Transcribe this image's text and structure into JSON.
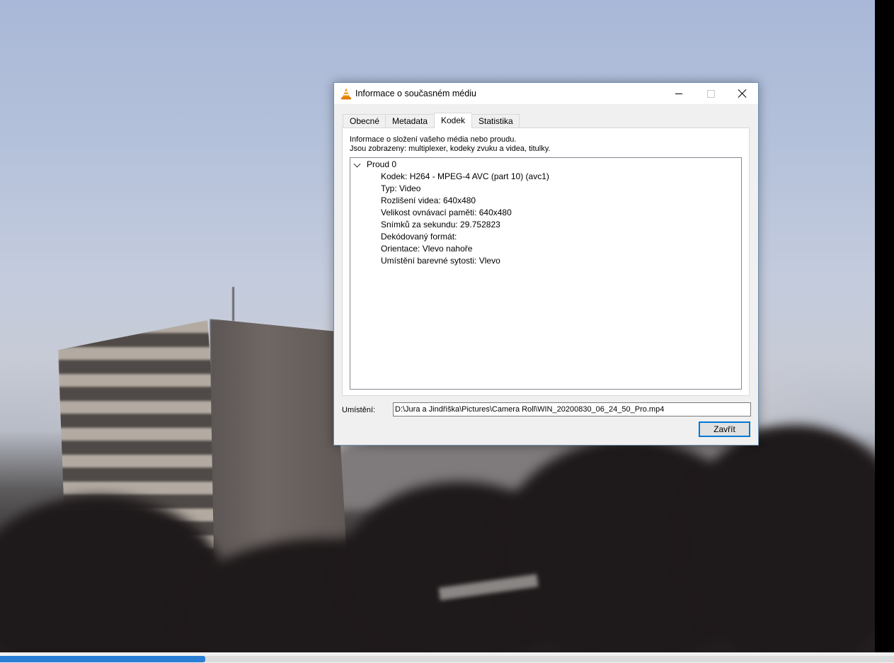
{
  "player": {
    "progress_fraction": 0.23
  },
  "dialog": {
    "title": "Informace o současném médiu",
    "tabs": [
      {
        "label": "Obecné"
      },
      {
        "label": "Metadata"
      },
      {
        "label": "Kodek"
      },
      {
        "label": "Statistika"
      }
    ],
    "active_tab": "Kodek",
    "description_line1": "Informace o složení vašeho média nebo proudu.",
    "description_line2": "Jsou zobrazeny: multiplexer, kodeky zvuku a videa, titulky.",
    "stream": {
      "label": "Proud 0",
      "expanded": true,
      "details": [
        "Kodek: H264 - MPEG-4 AVC (part 10) (avc1)",
        "Typ: Video",
        "Rozlišení videa: 640x480",
        "Velikost ovnávací paměti: 640x480",
        "Snímků za sekundu: 29.752823",
        "Dekódovaný formát:",
        "Orientace: Vlevo nahoře",
        "Umístění barevné sytosti: Vlevo"
      ]
    },
    "location_label": "Umístění:",
    "location_value": "D:\\Jura a Jindřiška\\Pictures\\Camera Roll\\WIN_20200830_06_24_50_Pro.mp4",
    "close_label": "Zavřít"
  },
  "colors": {
    "accent": "#0078d7",
    "progress": "#2a7fd4",
    "vlc_orange": "#f08a00"
  },
  "icons": {
    "app": "vlc-cone-icon",
    "minimize": "minimize-icon",
    "maximize": "maximize-icon",
    "close": "close-icon",
    "expand": "chevron-down-icon"
  }
}
